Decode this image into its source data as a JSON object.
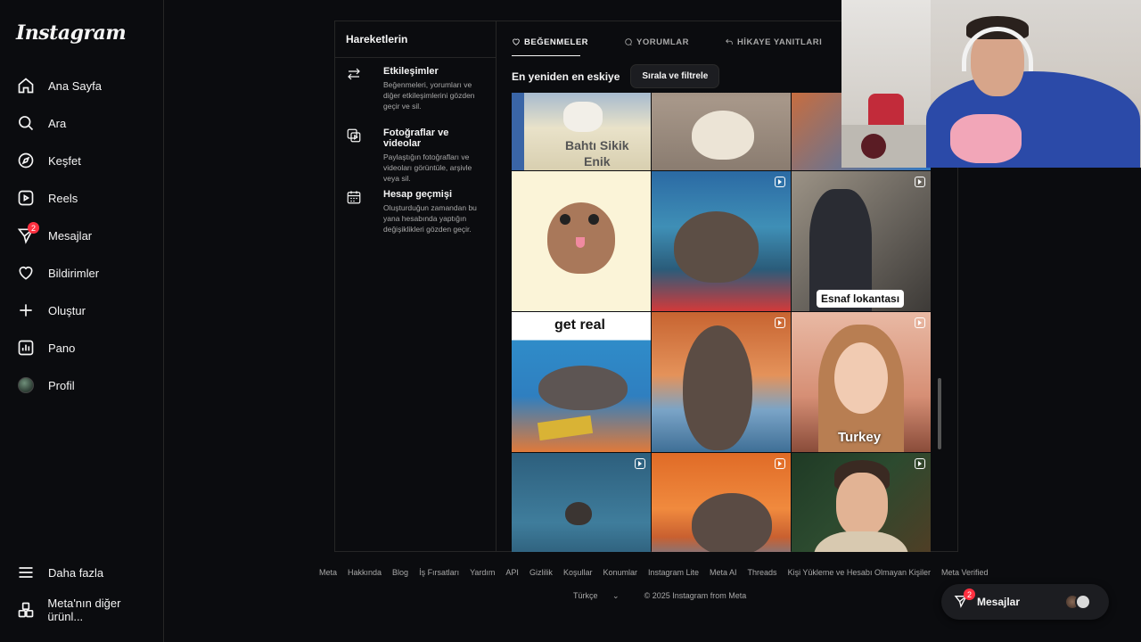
{
  "app": {
    "logo": "Instagram"
  },
  "sidebar": {
    "items": [
      {
        "label": "Ana Sayfa",
        "icon": "home-icon"
      },
      {
        "label": "Ara",
        "icon": "search-icon"
      },
      {
        "label": "Keşfet",
        "icon": "compass-icon"
      },
      {
        "label": "Reels",
        "icon": "reels-icon"
      },
      {
        "label": "Mesajlar",
        "icon": "messenger-icon",
        "badge": "2"
      },
      {
        "label": "Bildirimler",
        "icon": "heart-icon"
      },
      {
        "label": "Oluştur",
        "icon": "plus-icon"
      },
      {
        "label": "Pano",
        "icon": "dashboard-icon"
      },
      {
        "label": "Profil",
        "icon": "avatar"
      }
    ],
    "more": {
      "label": "Daha fazla",
      "icon": "menu-icon"
    },
    "meta": {
      "label": "Meta'nın diğer ürünl...",
      "icon": "apps-icon"
    }
  },
  "activity": {
    "title": "Hareketlerin",
    "sections": [
      {
        "title": "Etkileşimler",
        "desc": "Beğenmeleri, yorumları ve diğer etkileşimlerini gözden geçir ve sil.",
        "icon": "arrows-icon"
      },
      {
        "title": "Fotoğraflar ve videolar",
        "desc": "Paylaştığın fotoğrafları ve videoları görüntüle, arşivle veya sil.",
        "icon": "media-icon"
      },
      {
        "title": "Hesap geçmişi",
        "desc": "Oluşturduğun zamandan bu yana hesabında yaptığın değişiklikleri gözden geçir.",
        "icon": "calendar-icon"
      }
    ],
    "tabs": [
      {
        "label": "BEĞENMELER",
        "icon": "heart-icon",
        "active": true
      },
      {
        "label": "YORUMLAR",
        "icon": "comment-icon",
        "active": false
      },
      {
        "label": "HİKAYE YANITLARI",
        "icon": "reply-icon",
        "active": false
      }
    ],
    "sort_label": "En yeniden en eskiye",
    "sort_button": "Sırala ve filtrele",
    "captions": {
      "tile1": "Bahtı Sikik\nEnik",
      "tile6": "Esnaf lokantası",
      "tile7": "get real",
      "tile9": "Turkey"
    }
  },
  "footer": {
    "links": [
      "Meta",
      "Hakkında",
      "Blog",
      "İş Fırsatları",
      "Yardım",
      "API",
      "Gizlilik",
      "Koşullar",
      "Konumlar",
      "Instagram Lite",
      "Meta AI",
      "Threads",
      "Kişi Yükleme ve Hesabı Olmayan Kişiler",
      "Meta Verified"
    ],
    "language": "Türkçe",
    "copyright": "© 2025 Instagram from Meta"
  },
  "messages_pill": {
    "label": "Mesajlar",
    "badge": "2"
  },
  "colors": {
    "background": "#0b0c0f",
    "badge": "#ff3040",
    "text": "#f5f5f5",
    "muted": "#a8a8a8"
  }
}
